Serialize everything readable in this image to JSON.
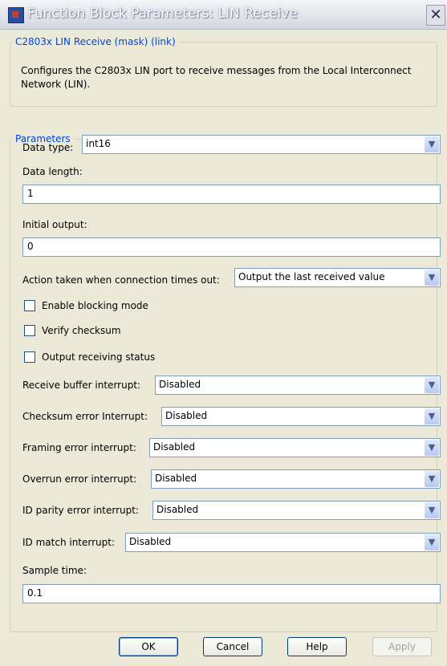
{
  "window": {
    "title": "Function Block Parameters: LIN Receive",
    "close_glyph": "✕"
  },
  "mask": {
    "legend": "C2803x LIN Receive (mask) (link)",
    "description": "Configures the C2803x LIN port to receive messages from the Local Interconnect Network (LIN)."
  },
  "params": {
    "legend": "Parameters",
    "data_type_label": "Data type:",
    "data_type_value": "int16",
    "data_length_label": "Data length:",
    "data_length_value": "1",
    "initial_output_label": "Initial output:",
    "initial_output_value": "0",
    "timeout_label": "Action taken when connection times out:",
    "timeout_value": "Output the last received value",
    "blocking_label": "Enable blocking mode",
    "checksum_label": "Verify checksum",
    "status_label": "Output receiving status",
    "rx_buffer_label": "Receive buffer interrupt:",
    "rx_buffer_value": "Disabled",
    "checksum_err_label": "Checksum error Interrupt:",
    "checksum_err_value": "Disabled",
    "framing_label": "Framing error interrupt:",
    "framing_value": "Disabled",
    "overrun_label": "Overrun error interrupt:",
    "overrun_value": "Disabled",
    "id_parity_label": "ID parity error interrupt:",
    "id_parity_value": "Disabled",
    "id_match_label": "ID match interrupt:",
    "id_match_value": "Disabled",
    "sample_time_label": "Sample time:",
    "sample_time_value": "0.1",
    "dropdown_arrow": "▼"
  },
  "buttons": {
    "ok": "OK",
    "cancel": "Cancel",
    "help": "Help",
    "apply": "Apply"
  }
}
